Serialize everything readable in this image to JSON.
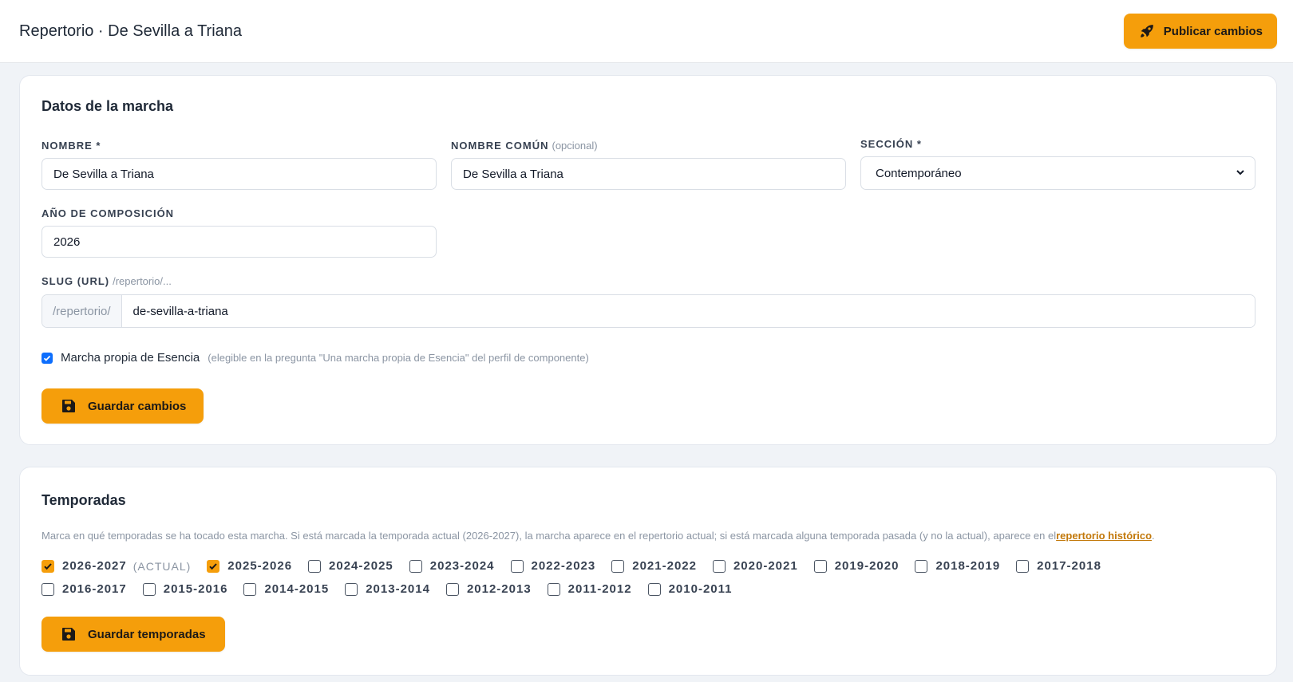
{
  "header": {
    "title": "Repertorio · De Sevilla a Triana",
    "publish_label": "Publicar cambios"
  },
  "datos": {
    "title": "Datos de la marcha",
    "nombre_label": "NOMBRE *",
    "nombre_value": "De Sevilla a Triana",
    "nombre_comun_label": "NOMBRE COMÚN",
    "nombre_comun_hint": "(opcional)",
    "nombre_comun_value": "De Sevilla a Triana",
    "seccion_label": "SECCIÓN *",
    "seccion_value": "Contemporáneo",
    "anio_label": "AÑO DE COMPOSICIÓN",
    "anio_value": "2026",
    "slug_label": "SLUG (URL)",
    "slug_hint": "/repertorio/...",
    "slug_prefix": "/repertorio/",
    "slug_value": "de-sevilla-a-triana",
    "propia_label": "Marcha propia de Esencia",
    "propia_note": "(elegible en la pregunta \"Una marcha propia de Esencia\" del perfil de componente)",
    "propia_checked": true,
    "save_label": "Guardar cambios"
  },
  "temporadas": {
    "title": "Temporadas",
    "note_text": "Marca en qué temporadas se ha tocado esta marcha. Si está marcada la temporada actual (2026-2027), la marcha aparece en el repertorio actual; si está marcada alguna temporada pasada (y no la actual), aparece en el",
    "note_link": "repertorio histórico",
    "note_end": ".",
    "current_tag": "(ACTUAL)",
    "row1": [
      {
        "label": "2026-2027",
        "checked": true
      },
      {
        "label": "2025-2026",
        "checked": true
      },
      {
        "label": "2024-2025",
        "checked": false
      },
      {
        "label": "2023-2024",
        "checked": false
      },
      {
        "label": "2022-2023",
        "checked": false
      },
      {
        "label": "2021-2022",
        "checked": false
      },
      {
        "label": "2020-2021",
        "checked": false
      },
      {
        "label": "2019-2020",
        "checked": false
      },
      {
        "label": "2018-2019",
        "checked": false
      },
      {
        "label": "2017-2018",
        "checked": false
      }
    ],
    "row2": [
      {
        "label": "2016-2017",
        "checked": false
      },
      {
        "label": "2015-2016",
        "checked": false
      },
      {
        "label": "2014-2015",
        "checked": false
      },
      {
        "label": "2013-2014",
        "checked": false
      },
      {
        "label": "2012-2013",
        "checked": false
      },
      {
        "label": "2011-2012",
        "checked": false
      },
      {
        "label": "2010-2011",
        "checked": false
      }
    ],
    "save_label": "Guardar temporadas"
  },
  "colors": {
    "accent": "#f59e0b",
    "checkbox_blue": "#0d6efd",
    "link": "#c2780a",
    "background": "#f0f3f7"
  },
  "icons": {
    "publish": "rocket-icon",
    "save": "floppy-disk-icon",
    "select": "chevron-down-icon",
    "check": "check-icon"
  }
}
